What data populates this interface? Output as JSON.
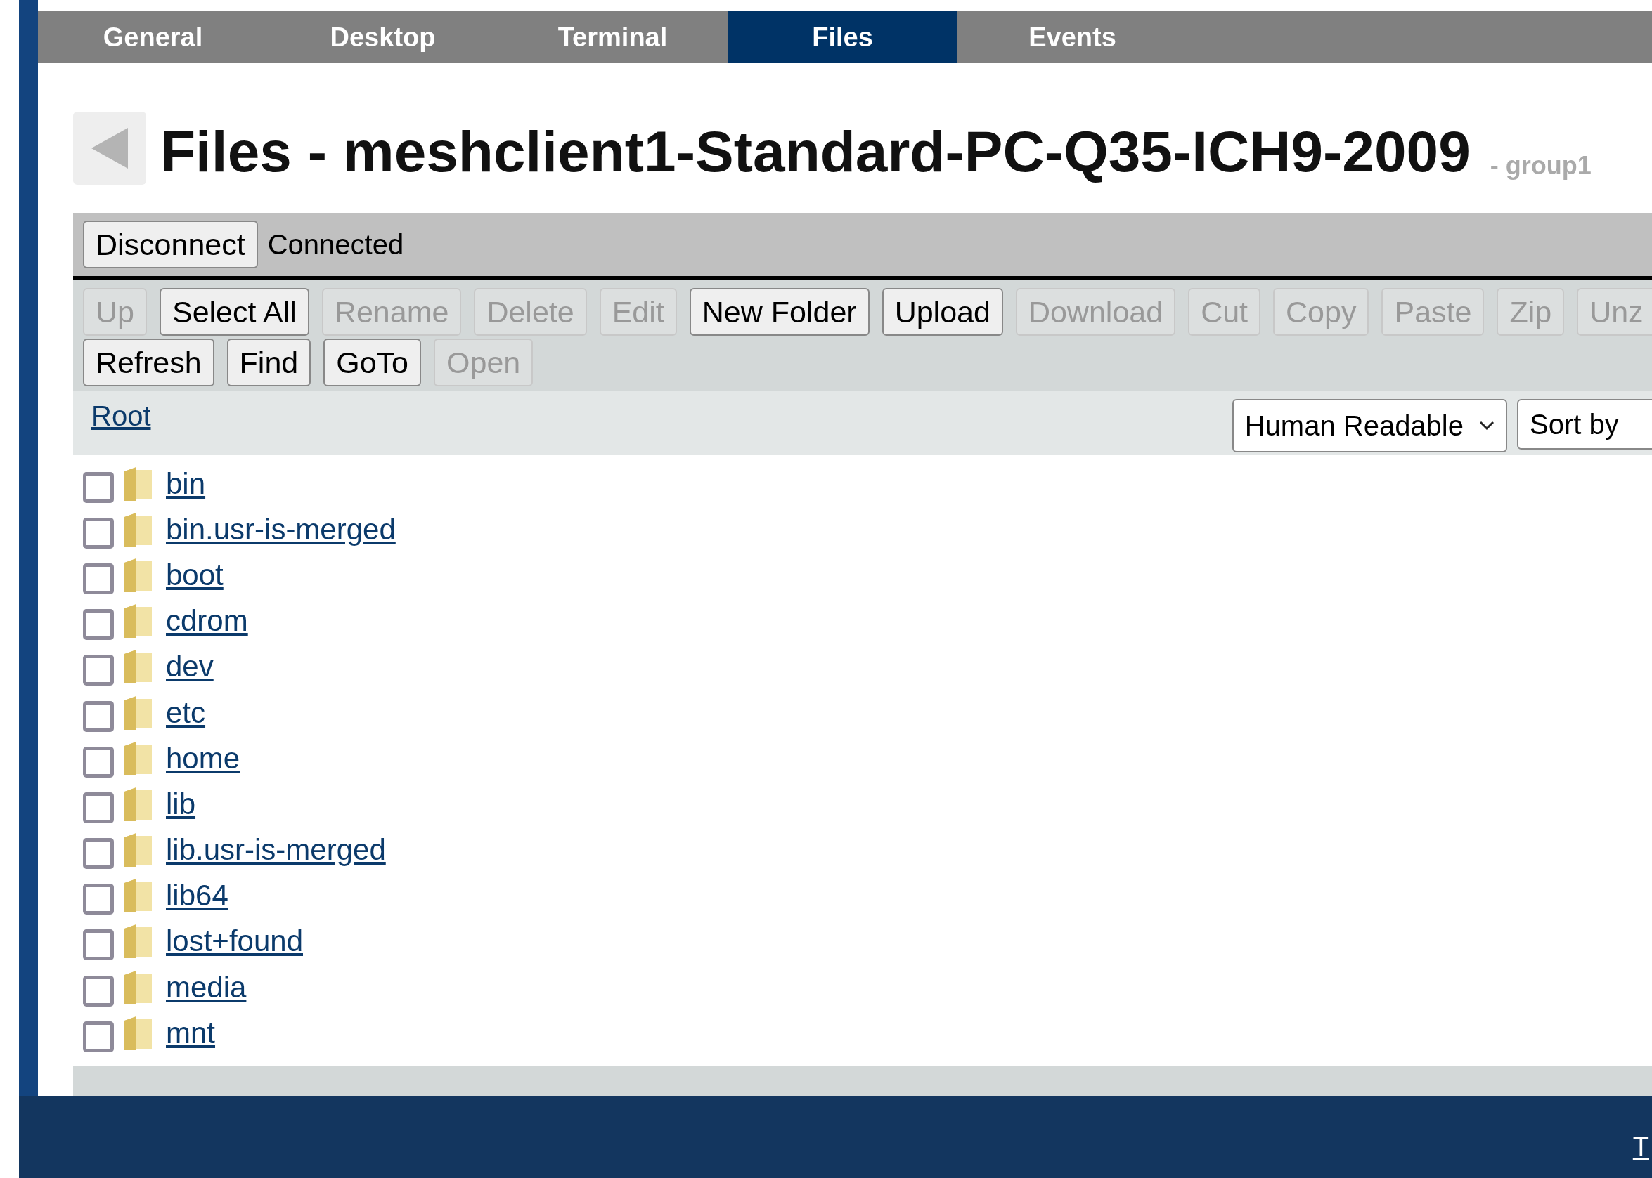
{
  "tabs": [
    {
      "label": "General",
      "selected": false
    },
    {
      "label": "Desktop",
      "selected": false
    },
    {
      "label": "Terminal",
      "selected": false
    },
    {
      "label": "Files",
      "selected": true
    },
    {
      "label": "Events",
      "selected": false
    }
  ],
  "title": "Files - meshclient1-Standard-PC-Q35-ICH9-2009",
  "group": "- group1",
  "connection": {
    "button": "Disconnect",
    "status": "Connected"
  },
  "toolbar_rows": [
    [
      {
        "label": "Up",
        "disabled": true
      },
      {
        "label": "Select All",
        "disabled": false
      },
      {
        "label": "Rename",
        "disabled": true
      },
      {
        "label": "Delete",
        "disabled": true
      },
      {
        "label": "Edit",
        "disabled": true
      },
      {
        "label": "New Folder",
        "disabled": false
      },
      {
        "label": "Upload",
        "disabled": false
      },
      {
        "label": "Download",
        "disabled": true
      },
      {
        "label": "Cut",
        "disabled": true
      },
      {
        "label": "Copy",
        "disabled": true
      },
      {
        "label": "Paste",
        "disabled": true
      },
      {
        "label": "Zip",
        "disabled": true
      },
      {
        "label": "Unz",
        "disabled": true
      }
    ],
    [
      {
        "label": "Refresh",
        "disabled": false
      },
      {
        "label": "Find",
        "disabled": false
      },
      {
        "label": "GoTo",
        "disabled": false
      },
      {
        "label": "Open",
        "disabled": true
      }
    ]
  ],
  "path": "Root",
  "size_format": "Human Readable",
  "sort": "Sort by",
  "files": [
    {
      "name": "bin",
      "checked": false
    },
    {
      "name": "bin.usr-is-merged",
      "checked": false
    },
    {
      "name": "boot",
      "checked": false
    },
    {
      "name": "cdrom",
      "checked": false
    },
    {
      "name": "dev",
      "checked": false
    },
    {
      "name": "etc",
      "checked": false
    },
    {
      "name": "home",
      "checked": false
    },
    {
      "name": "lib",
      "checked": false
    },
    {
      "name": "lib.usr-is-merged",
      "checked": false
    },
    {
      "name": "lib64",
      "checked": false
    },
    {
      "name": "lost+found",
      "checked": false
    },
    {
      "name": "media",
      "checked": false
    },
    {
      "name": "mnt",
      "checked": false
    }
  ],
  "footer_link": "T"
}
